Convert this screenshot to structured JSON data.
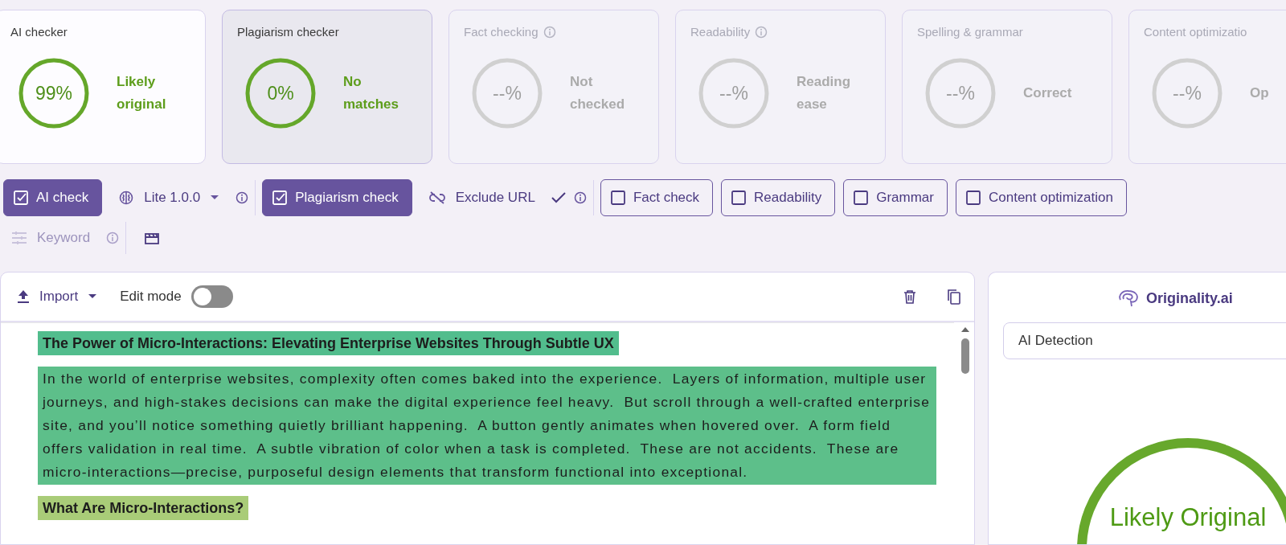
{
  "cards": [
    {
      "title": "AI checker",
      "info": false,
      "disabled": false,
      "selected": false,
      "percent": "99%",
      "status": "Likely original"
    },
    {
      "title": "Plagiarism checker",
      "info": false,
      "disabled": false,
      "selected": true,
      "percent": "0%",
      "status": "No matches"
    },
    {
      "title": "Fact checking",
      "info": true,
      "disabled": true,
      "selected": false,
      "percent": "--%",
      "status": "Not checked"
    },
    {
      "title": "Readability",
      "info": true,
      "disabled": true,
      "selected": false,
      "percent": "--%",
      "status": "Reading ease"
    },
    {
      "title": "Spelling & grammar",
      "info": false,
      "disabled": true,
      "selected": false,
      "percent": "--%",
      "status": "Correct"
    },
    {
      "title": "Content optimizatio",
      "info": false,
      "disabled": true,
      "selected": false,
      "percent": "--%",
      "status": "Op"
    }
  ],
  "toolbar": {
    "row_1": [
      [
        {
          "kind": "toggle",
          "label": "AI check",
          "checked": true
        },
        {
          "kind": "model",
          "label": "Lite 1.0.0",
          "info": true
        }
      ],
      [
        {
          "kind": "toggle",
          "label": "Plagiarism check",
          "checked": true
        },
        {
          "kind": "exclude",
          "label": "Exclude URL",
          "confirmed": true,
          "info": true
        }
      ],
      [
        {
          "kind": "toggle",
          "label": "Fact check",
          "checked": false
        },
        {
          "kind": "toggle",
          "label": "Readability",
          "checked": false
        },
        {
          "kind": "toggle",
          "label": "Grammar",
          "checked": false
        },
        {
          "kind": "toggle",
          "label": "Content optimization",
          "checked": false
        }
      ]
    ],
    "row_2": [
      [
        {
          "kind": "keyword",
          "label": "Keyword",
          "disabled": true,
          "info": true
        }
      ],
      [
        {
          "kind": "clapper"
        }
      ]
    ]
  },
  "editor": {
    "import_label": "Import",
    "edit_mode": {
      "label": "Edit mode",
      "on": false
    },
    "blocks": [
      {
        "kind": "heading",
        "color": "#52bd8d",
        "text": "The Power of Micro-Interactions: Elevating Enterprise Websites Through Subtle UX"
      },
      {
        "kind": "paragraph",
        "color": "#5dbf8a",
        "text": "In the world of enterprise websites, complexity often comes baked into the experience.  Layers of information, multiple user journeys, and high-stakes decisions can make the digital experience feel heavy.  But scroll through a well-crafted enterprise site, and you’ll notice something quietly brilliant happening.  A button gently animates when hovered over.  A form field offers validation in real time.  A subtle vibration of color when a task is completed.  These are not accidents.  These are micro-interactions—precise, purposeful design elements that transform functional into exceptional."
      },
      {
        "kind": "heading",
        "color": "#a9cc78",
        "text": "What Are Micro-Interactions?"
      }
    ]
  },
  "result_panel": {
    "brand": "Originality.ai",
    "mode_select": "AI Detection",
    "result": "Likely Original"
  }
}
